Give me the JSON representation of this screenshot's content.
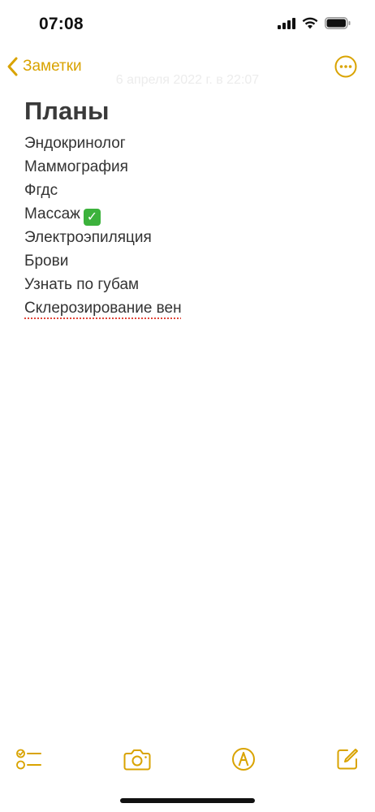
{
  "status_bar": {
    "time": "07:08",
    "icons": [
      "cellular-signal-icon",
      "wifi-icon",
      "battery-icon"
    ]
  },
  "nav": {
    "back_label": "Заметки",
    "back_icon": "chevron-left-icon",
    "more_icon": "ellipsis-circle-icon",
    "date_text": "6 апреля 2022 г. в 22:07"
  },
  "note": {
    "title": "Планы",
    "lines": [
      "Эндокринолог",
      "Маммография",
      "Фгдс",
      "Массаж",
      "Электроэпиляция",
      "Брови",
      "Узнать по губам",
      "Склерозирование вен"
    ],
    "checked_emoji": "✓"
  },
  "toolbar": {
    "icons": [
      "checklist-icon",
      "camera-icon",
      "markup-pen-icon",
      "compose-icon"
    ]
  },
  "colors": {
    "accent": "#d9a300",
    "text": "#333333",
    "spellcheck": "#e0463a",
    "emoji_check_bg": "#3cb23c"
  }
}
